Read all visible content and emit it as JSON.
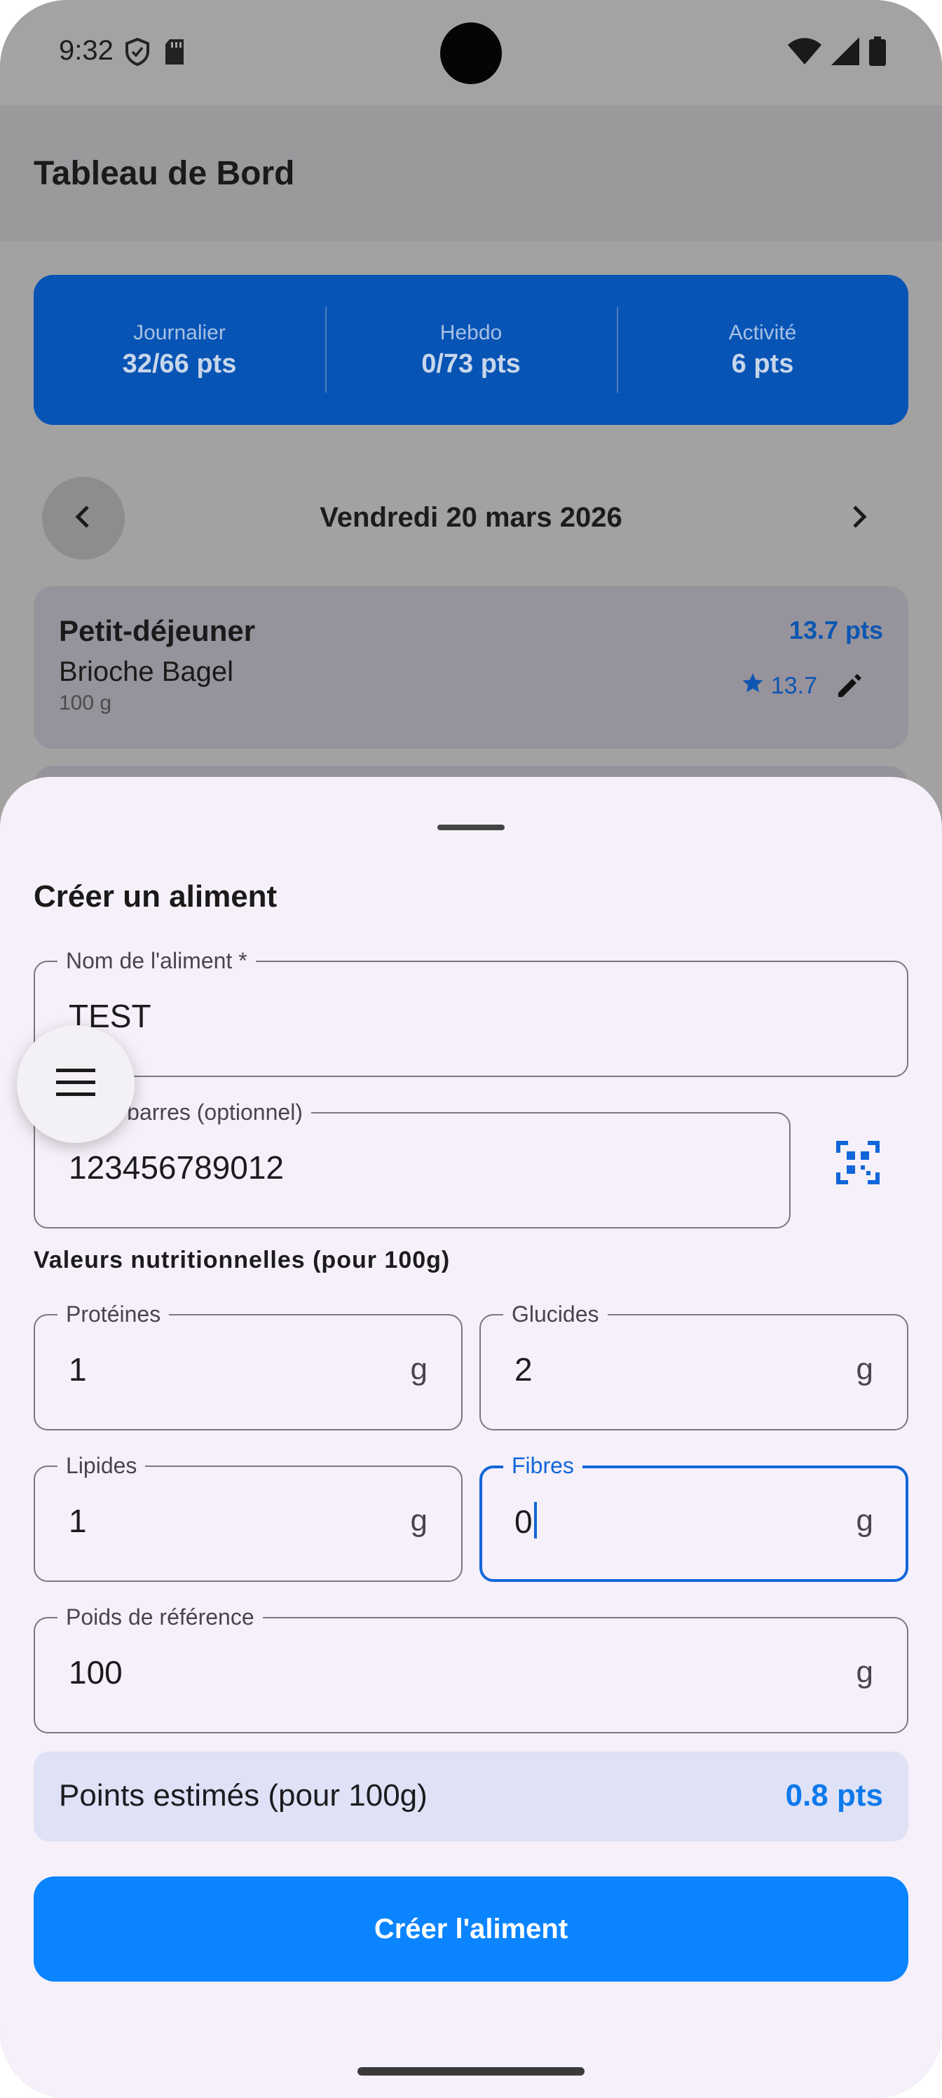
{
  "status_bar": {
    "time": "9:32",
    "icons": [
      "shield-icon",
      "sd-card-icon",
      "wifi-icon",
      "signal-icon",
      "battery-icon"
    ]
  },
  "app_bar": {
    "title": "Tableau de Bord"
  },
  "stats": [
    {
      "label": "Journalier",
      "value": "32/66 pts"
    },
    {
      "label": "Hebdo",
      "value": "0/73 pts"
    },
    {
      "label": "Activité",
      "value": "6 pts"
    }
  ],
  "date_nav": {
    "date": "Vendredi 20 mars 2026"
  },
  "meal": {
    "title": "Petit-déjeuner",
    "points": "13.7 pts",
    "item_name": "Brioche Bagel",
    "item_weight": "100 g",
    "item_points": "13.7"
  },
  "sheet": {
    "title": "Créer un aliment",
    "name_field": {
      "label": "Nom de l'aliment *",
      "value": "TEST"
    },
    "barcode_field": {
      "label": "Code-barres (optionnel)",
      "value": "123456789012"
    },
    "section_label": "Valeurs nutritionnelles (pour 100g)",
    "proteins": {
      "label": "Protéines",
      "value": "1",
      "unit": "g"
    },
    "carbs": {
      "label": "Glucides",
      "value": "2",
      "unit": "g"
    },
    "fats": {
      "label": "Lipides",
      "value": "1",
      "unit": "g"
    },
    "fibers": {
      "label": "Fibres",
      "value": "0",
      "unit": "g"
    },
    "ref_weight": {
      "label": "Poids de référence",
      "value": "100",
      "unit": "g"
    },
    "estimate": {
      "label": "Points estimés (pour 100g)",
      "value": "0.8 pts"
    },
    "submit_label": "Créer l'aliment"
  },
  "colors": {
    "primary": "#0a84ff",
    "stats_card": "#0754b5",
    "focus": "#1166d9",
    "sheet_bg": "#f5f0f9",
    "estimate_bg": "#dfe2f6"
  }
}
